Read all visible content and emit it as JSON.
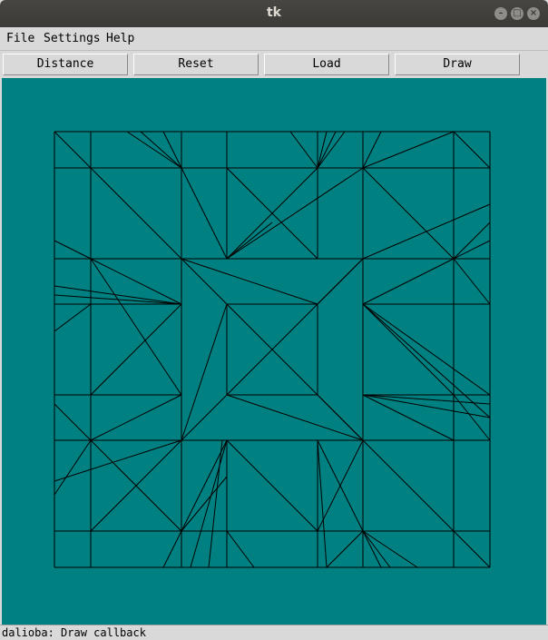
{
  "window": {
    "title": "tk",
    "minimize_glyph": "–",
    "maximize_glyph": "□",
    "close_glyph": "×"
  },
  "menu": {
    "items": [
      "File",
      "Settings",
      "Help"
    ]
  },
  "toolbar": {
    "buttons": [
      "Distance",
      "Reset",
      "Load",
      "Draw"
    ]
  },
  "canvas": {
    "background": "#008080",
    "stroke": "#000000"
  },
  "status": {
    "text": "dalioba: Draw callback"
  }
}
